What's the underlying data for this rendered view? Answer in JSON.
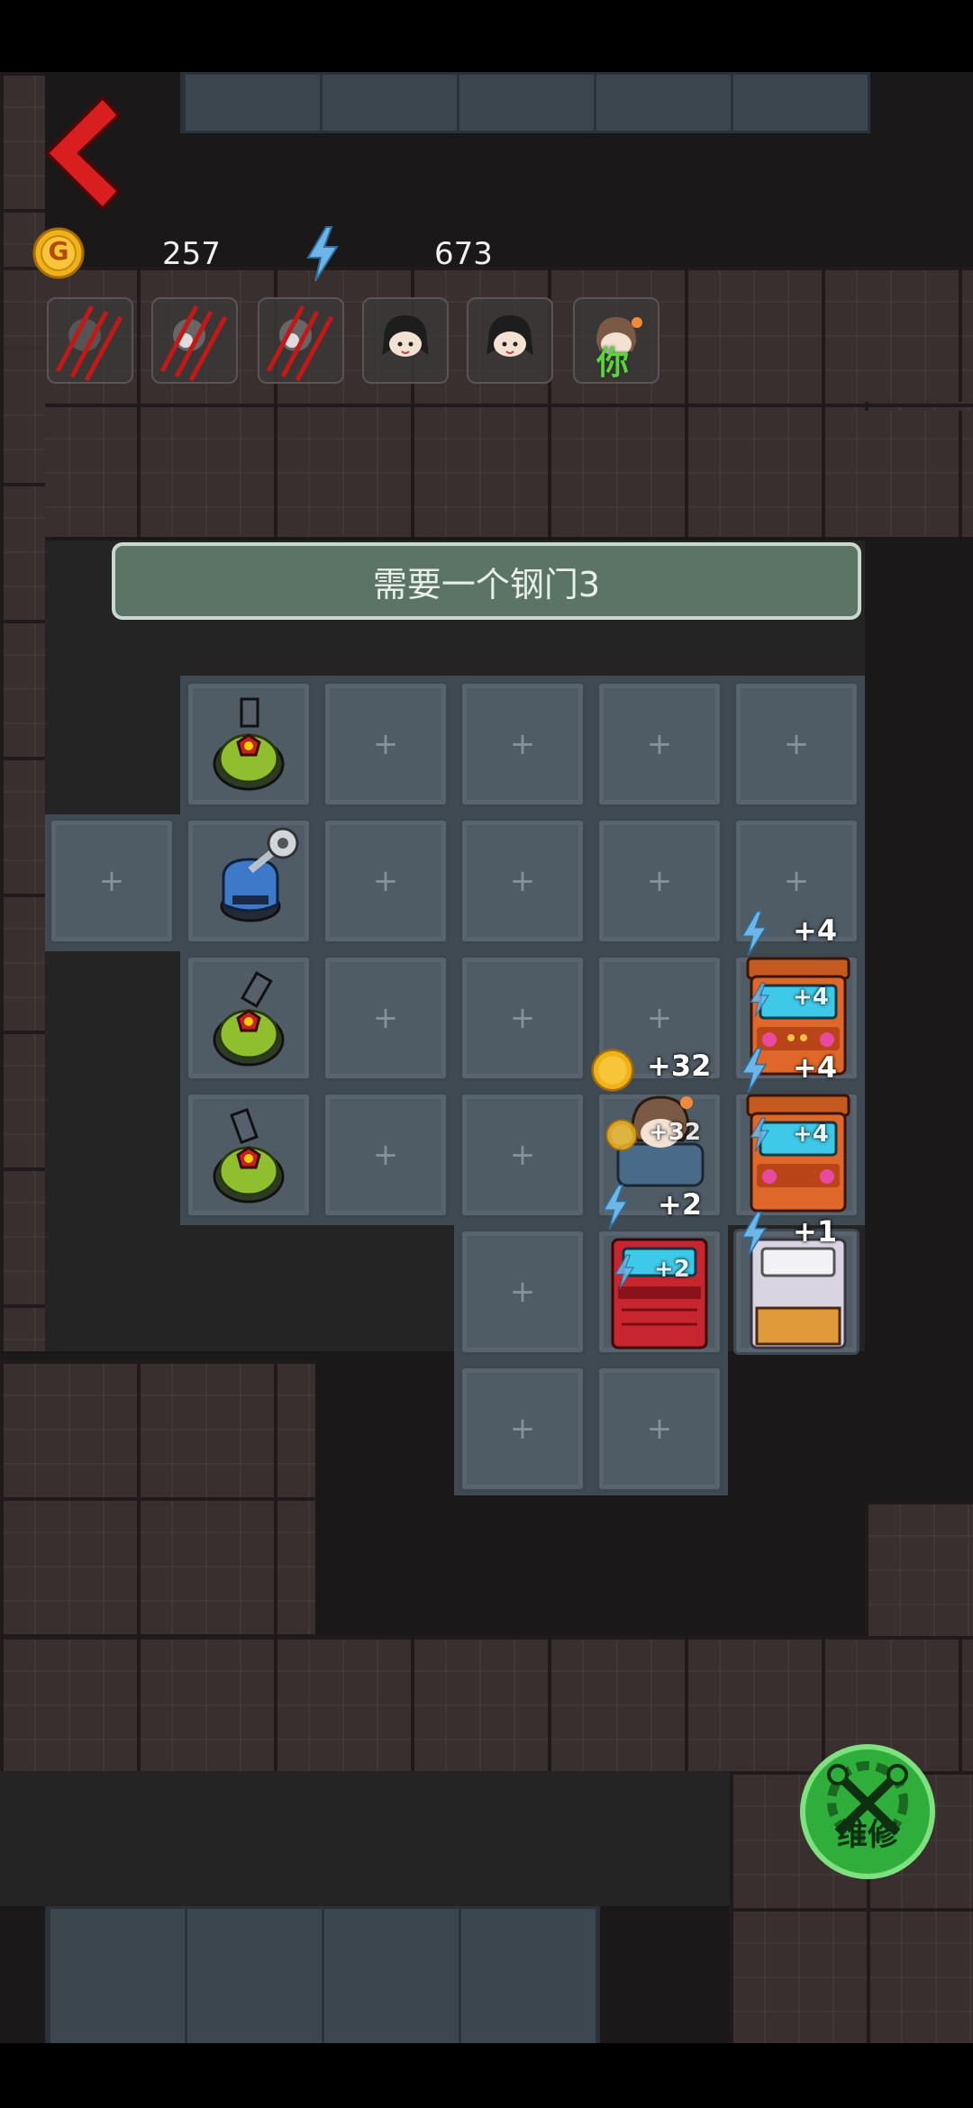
{
  "resources": {
    "coins": "257",
    "energy": "673",
    "coin_icon_letter": "G"
  },
  "party": {
    "you_label": "你"
  },
  "banner": {
    "text": "需要一个钢门3"
  },
  "floor": {
    "plus": "+"
  },
  "gains": {
    "coin_big": "+32",
    "coin_small": "+32",
    "arcade1_big": "+4",
    "arcade1_small": "+4",
    "arcade2_big": "+4",
    "arcade2_small": "+4",
    "arcade3_big": "+2",
    "arcade3_small": "+2",
    "arcade4_big": "+1"
  },
  "repair": {
    "label": "维修"
  },
  "colors": {
    "accent_red": "#d81e1e",
    "coin_gold": "#f0b21a",
    "energy_blue": "#6fb6e8",
    "repair_green": "#2fae3c"
  }
}
